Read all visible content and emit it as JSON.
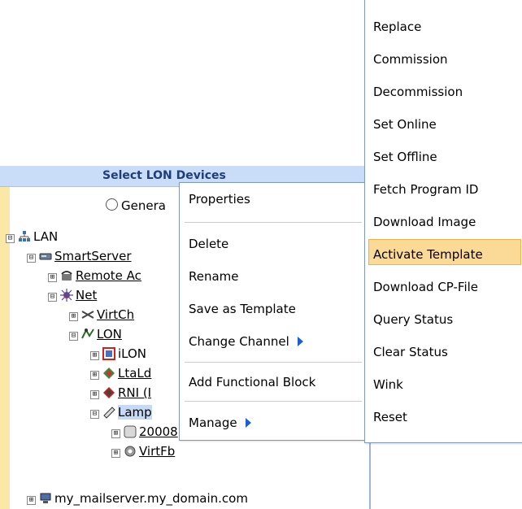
{
  "panel": {
    "title": "Select LON Devices",
    "radio_label": "Genera"
  },
  "tree": [
    {
      "label": "LAN",
      "exp": "⊟",
      "icon": "network-icon"
    },
    {
      "label": "SmartServer",
      "exp": "⊟",
      "icon": "server-icon"
    },
    {
      "label": "Remote Ac",
      "exp": "⊞",
      "icon": "phone-icon"
    },
    {
      "label": "Net",
      "exp": "⊟",
      "icon": "net-icon"
    },
    {
      "label": "VirtCh",
      "exp": "⊞",
      "icon": "channel-icon"
    },
    {
      "label": "LON",
      "exp": "⊟",
      "icon": "lon-channel-icon"
    },
    {
      "label": "iLON",
      "exp": "⊞",
      "icon": "ilon-device-icon"
    },
    {
      "label": "LtaLd",
      "exp": "⊞",
      "icon": "lta-device-icon"
    },
    {
      "label": "RNI (I",
      "exp": "⊞",
      "icon": "rni-device-icon"
    },
    {
      "label": "Lamp",
      "exp": "⊟",
      "icon": "lamp-device-icon"
    },
    {
      "label": "20008",
      "exp": "⊞",
      "icon": "block-icon"
    },
    {
      "label": "VirtFb",
      "exp": "⊞",
      "icon": "gear-icon"
    },
    {
      "label": "my_mailserver.my_domain.com",
      "exp": "⊞",
      "icon": "computer-icon"
    }
  ],
  "context_menu": {
    "items": [
      {
        "label": "Properties"
      },
      {
        "label": "Delete"
      },
      {
        "label": "Rename"
      },
      {
        "label": "Save as Template"
      },
      {
        "label": "Change Channel"
      },
      {
        "label": "Add Functional Block"
      },
      {
        "label": "Manage"
      }
    ]
  },
  "submenu": {
    "items": [
      {
        "label": "Replace"
      },
      {
        "label": "Commission"
      },
      {
        "label": "Decommission"
      },
      {
        "label": "Set Online"
      },
      {
        "label": "Set Offline"
      },
      {
        "label": "Fetch Program ID"
      },
      {
        "label": "Download Image"
      },
      {
        "label": "Activate Template"
      },
      {
        "label": "Download CP-File"
      },
      {
        "label": "Query Status"
      },
      {
        "label": "Clear Status"
      },
      {
        "label": "Wink"
      },
      {
        "label": "Reset"
      }
    ],
    "highlighted": "Activate Template"
  },
  "colors": {
    "header_bg": "#c9dcf8",
    "stripe": "#fbe7a6",
    "highlight": "#fbd996",
    "submenu_arrow": "#1e5fcf"
  }
}
